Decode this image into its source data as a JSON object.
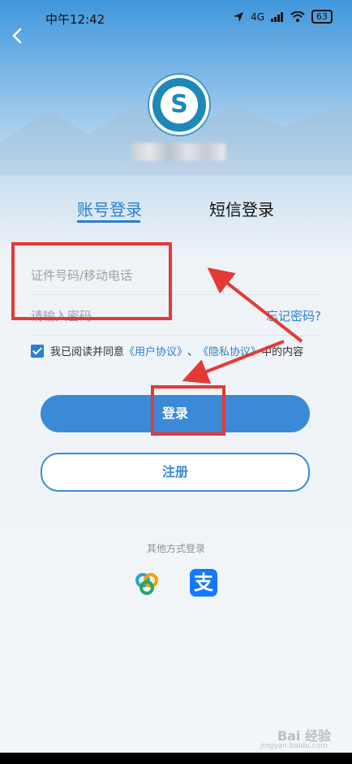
{
  "status_bar": {
    "time": "中午12:42",
    "signal": "4G",
    "battery": "63"
  },
  "tabs": {
    "account_login": "账号登录",
    "sms_login": "短信登录"
  },
  "form": {
    "id_placeholder": "证件号码/移动电话",
    "password_placeholder": "请输入密码",
    "forgot_password": "忘记密码?"
  },
  "agreement": {
    "prefix": "我已阅读并同意",
    "user_agreement": "《用户协议》",
    "separator": "、",
    "privacy_agreement": "《隐私协议》",
    "suffix": "中的内容",
    "checked": true
  },
  "buttons": {
    "login": "登录",
    "register": "注册"
  },
  "other_login": {
    "label": "其他方式登录",
    "alipay_glyph": "支"
  },
  "watermark": {
    "brand": "Bai 经验",
    "sub": "jingyan.baidu.com"
  },
  "colors": {
    "accent": "#2a7fd0",
    "annotation": "#e53935",
    "alipay": "#1677ff"
  }
}
